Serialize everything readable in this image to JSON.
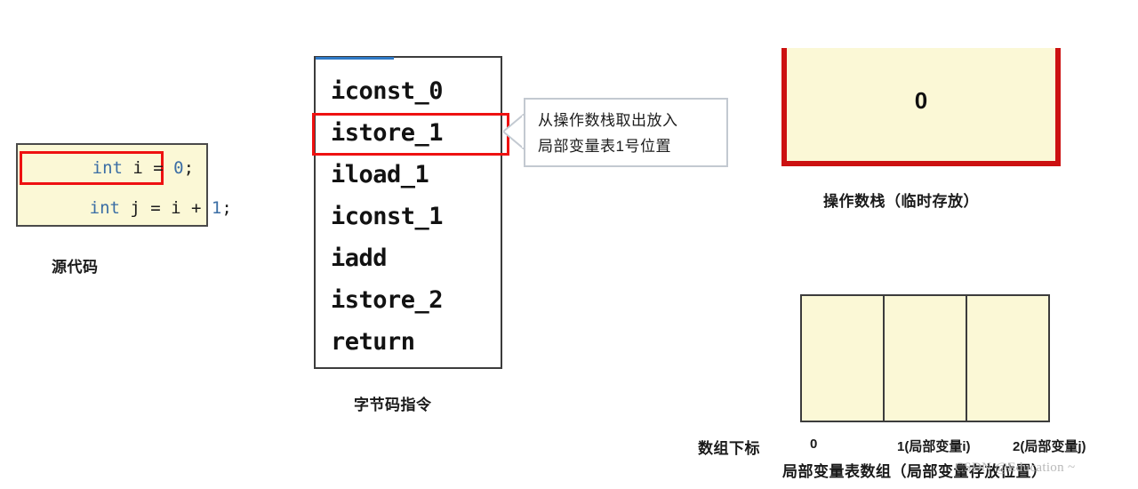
{
  "source_code": {
    "caption": "源代码",
    "lines": [
      {
        "tokens": [
          {
            "text": "int",
            "kind": "kw"
          },
          {
            "text": " i = ",
            "kind": "plain"
          },
          {
            "text": "0",
            "kind": "num"
          },
          {
            "text": ";",
            "kind": "plain"
          }
        ],
        "highlighted": true
      },
      {
        "tokens": [
          {
            "text": "int",
            "kind": "kw"
          },
          {
            "text": " j = i + ",
            "kind": "plain"
          },
          {
            "text": "1",
            "kind": "num"
          },
          {
            "text": ";",
            "kind": "plain"
          }
        ],
        "highlighted": false
      }
    ]
  },
  "bytecode": {
    "caption": "字节码指令",
    "instructions": [
      "iconst_0",
      "istore_1",
      "iload_1",
      "iconst_1",
      "iadd",
      "istore_2",
      "return"
    ],
    "highlighted_index": 1,
    "accent_color": "#2f79c6",
    "highlight_color": "#ee1111"
  },
  "callout": {
    "lines": [
      "从操作数栈取出放入",
      "局部变量表1号位置"
    ],
    "border_color": "#c3c9d1"
  },
  "operand_stack": {
    "caption": "操作数栈（临时存放）",
    "value": "0",
    "border_color": "#cc1111",
    "fill_color": "#fbf8d6"
  },
  "local_variable_table": {
    "caption": "局部变量表数组（局部变量存放位置）",
    "index_row_label": "数组下标",
    "slots": [
      {
        "index_label": "0",
        "value": ""
      },
      {
        "index_label": "1(局部变量i)",
        "value": ""
      },
      {
        "index_label": "2(局部变量j)",
        "value": ""
      }
    ],
    "fill_color": "#fbf8d6",
    "border_color": "#3c3c3c"
  },
  "watermark": {
    "text": "CSDN @Education ~"
  }
}
